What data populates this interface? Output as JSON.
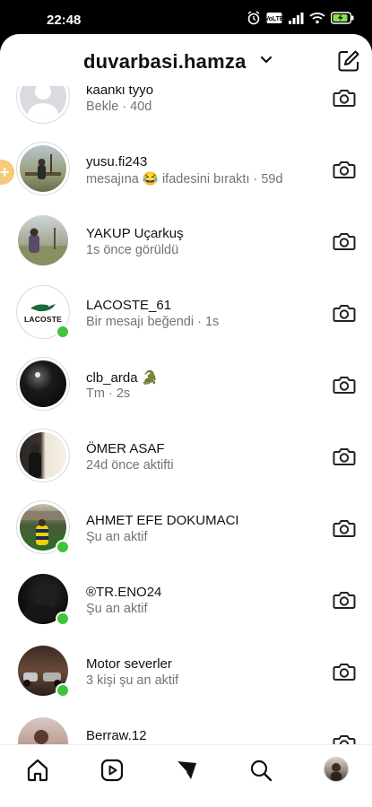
{
  "status": {
    "time": "22:48"
  },
  "header": {
    "username": "duvarbasi.hamza"
  },
  "conversations": [
    {
      "name": "kaanki tyyo",
      "sub": "Bekle · 40d"
    },
    {
      "name": "yusu.fi243",
      "sub": "mesajına 😂 ifadesini bıraktı · 59d"
    },
    {
      "name": "YAKUP Uçarkuş",
      "sub": "1s önce görüldü"
    },
    {
      "name": "LACOSTE_61",
      "sub": "Bir mesajı beğendi · 1s",
      "logo": "LACOSTE"
    },
    {
      "name": "clb_arda 🐊",
      "sub": "Tm · 2s"
    },
    {
      "name": "ÖMER ASAF",
      "sub": "24d önce aktifti"
    },
    {
      "name": "AHMET EFE DOKUMACI",
      "sub": "Şu an aktif"
    },
    {
      "name": "®TR.ENO24",
      "sub": "Şu an aktif"
    },
    {
      "name": "Motor severler",
      "sub": "3 kişi şu an aktif"
    },
    {
      "name": "Berraw.12",
      "sub": ""
    }
  ],
  "nav": [
    "home-icon",
    "reels-icon",
    "direct-icon",
    "search-icon",
    "profile-avatar"
  ],
  "colors": {
    "online": "#3fc53b",
    "subtext": "#737373",
    "accent": "#000000"
  }
}
